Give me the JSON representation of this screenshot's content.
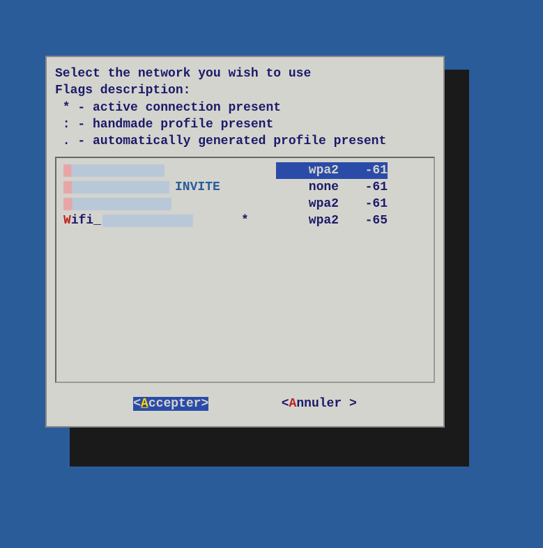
{
  "header": {
    "line1": "Select the network you wish to use",
    "line2": "Flags description:",
    "line3": " * - active connection present",
    "line4": " : - handmade profile present",
    "line5": " . - automatically generated profile present"
  },
  "networks": [
    {
      "ssid": "██████████████",
      "suffix": "",
      "flag": "",
      "security": "wpa2",
      "signal": "-61",
      "selected": true,
      "blurred": true
    },
    {
      "ssid": "██████████████",
      "suffix": "INVITE",
      "flag": "",
      "security": "none",
      "signal": "-61",
      "selected": false,
      "blurred": true
    },
    {
      "ssid": "██████████████",
      "suffix": "",
      "flag": "",
      "security": "wpa2",
      "signal": "-61",
      "selected": false,
      "blurred": true
    },
    {
      "ssid": "Wifi_██████████",
      "suffix": "",
      "flag": "*",
      "security": "wpa2",
      "signal": "-65",
      "selected": false,
      "blurred": false,
      "prefix_visible": "ifi_"
    }
  ],
  "buttons": {
    "accept": {
      "prefix": "<",
      "hotkey": "A",
      "rest": "ccepter>",
      "full": "<Accepter>"
    },
    "cancel": {
      "prefix": "<",
      "hotkey": "A",
      "rest": "nnuler >",
      "full": "<Annuler >"
    }
  },
  "colors": {
    "background": "#2a5c9a",
    "dialog_bg": "#d4d4ce",
    "text": "#1a1a6a",
    "highlight_bg": "#2a4ca8",
    "hotkey_selected": "#ffd700",
    "hotkey_red": "#c02020"
  }
}
